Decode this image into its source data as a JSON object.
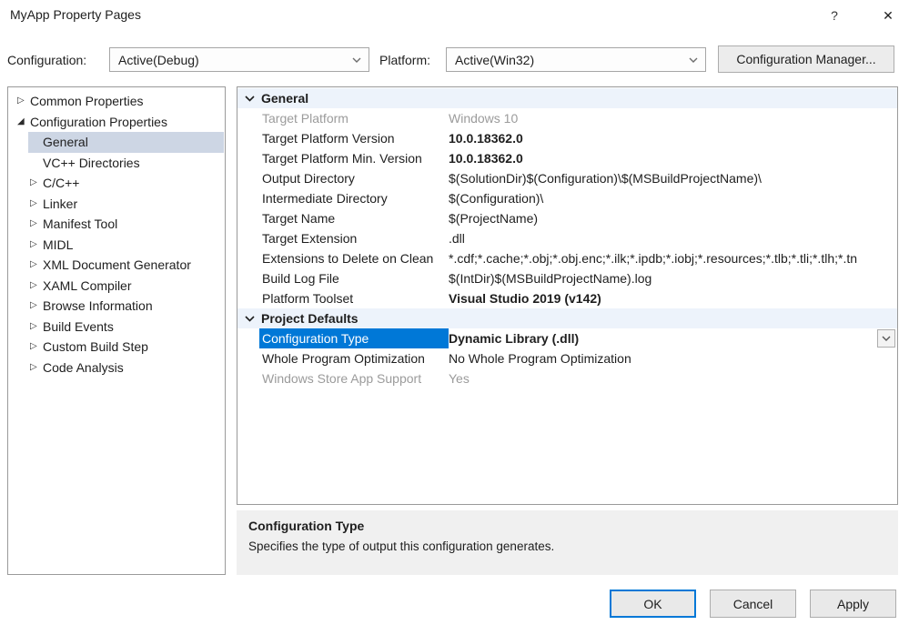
{
  "window": {
    "title": "MyApp Property Pages"
  },
  "icons": {
    "help": "?",
    "close": "✕",
    "tree_collapsed": "▷",
    "tree_expanded": "◢"
  },
  "config_bar": {
    "configuration_label": "Configuration:",
    "configuration_value": "Active(Debug)",
    "platform_label": "Platform:",
    "platform_value": "Active(Win32)",
    "manager_button": "Configuration Manager..."
  },
  "tree": {
    "items": [
      {
        "label": "Common Properties"
      },
      {
        "label": "Configuration Properties"
      },
      {
        "label": "General"
      },
      {
        "label": "VC++ Directories"
      },
      {
        "label": "C/C++"
      },
      {
        "label": "Linker"
      },
      {
        "label": "Manifest Tool"
      },
      {
        "label": "MIDL"
      },
      {
        "label": "XML Document Generator"
      },
      {
        "label": "XAML Compiler"
      },
      {
        "label": "Browse Information"
      },
      {
        "label": "Build Events"
      },
      {
        "label": "Custom Build Step"
      },
      {
        "label": "Code Analysis"
      }
    ]
  },
  "grid": {
    "sections": [
      {
        "title": "General",
        "rows": [
          {
            "label": "Target Platform",
            "value": "Windows 10"
          },
          {
            "label": "Target Platform Version",
            "value": "10.0.18362.0"
          },
          {
            "label": "Target Platform Min. Version",
            "value": "10.0.18362.0"
          },
          {
            "label": "Output Directory",
            "value": "$(SolutionDir)$(Configuration)\\$(MSBuildProjectName)\\"
          },
          {
            "label": "Intermediate Directory",
            "value": "$(Configuration)\\"
          },
          {
            "label": "Target Name",
            "value": "$(ProjectName)"
          },
          {
            "label": "Target Extension",
            "value": ".dll"
          },
          {
            "label": "Extensions to Delete on Clean",
            "value": "*.cdf;*.cache;*.obj;*.obj.enc;*.ilk;*.ipdb;*.iobj;*.resources;*.tlb;*.tli;*.tlh;*.tn"
          },
          {
            "label": "Build Log File",
            "value": "$(IntDir)$(MSBuildProjectName).log"
          },
          {
            "label": "Platform Toolset",
            "value": "Visual Studio 2019 (v142)"
          }
        ]
      },
      {
        "title": "Project Defaults",
        "rows": [
          {
            "label": "Configuration Type",
            "value": "Dynamic Library (.dll)"
          },
          {
            "label": "Whole Program Optimization",
            "value": "No Whole Program Optimization"
          },
          {
            "label": "Windows Store App Support",
            "value": "Yes"
          }
        ]
      }
    ]
  },
  "description": {
    "title": "Configuration Type",
    "text": "Specifies the type of output this configuration generates."
  },
  "buttons": {
    "ok": "OK",
    "cancel": "Cancel",
    "apply": "Apply"
  },
  "colors": {
    "accent": "#0078d7",
    "selection": "#cdd6e4",
    "section_bg": "#edf3fb"
  }
}
